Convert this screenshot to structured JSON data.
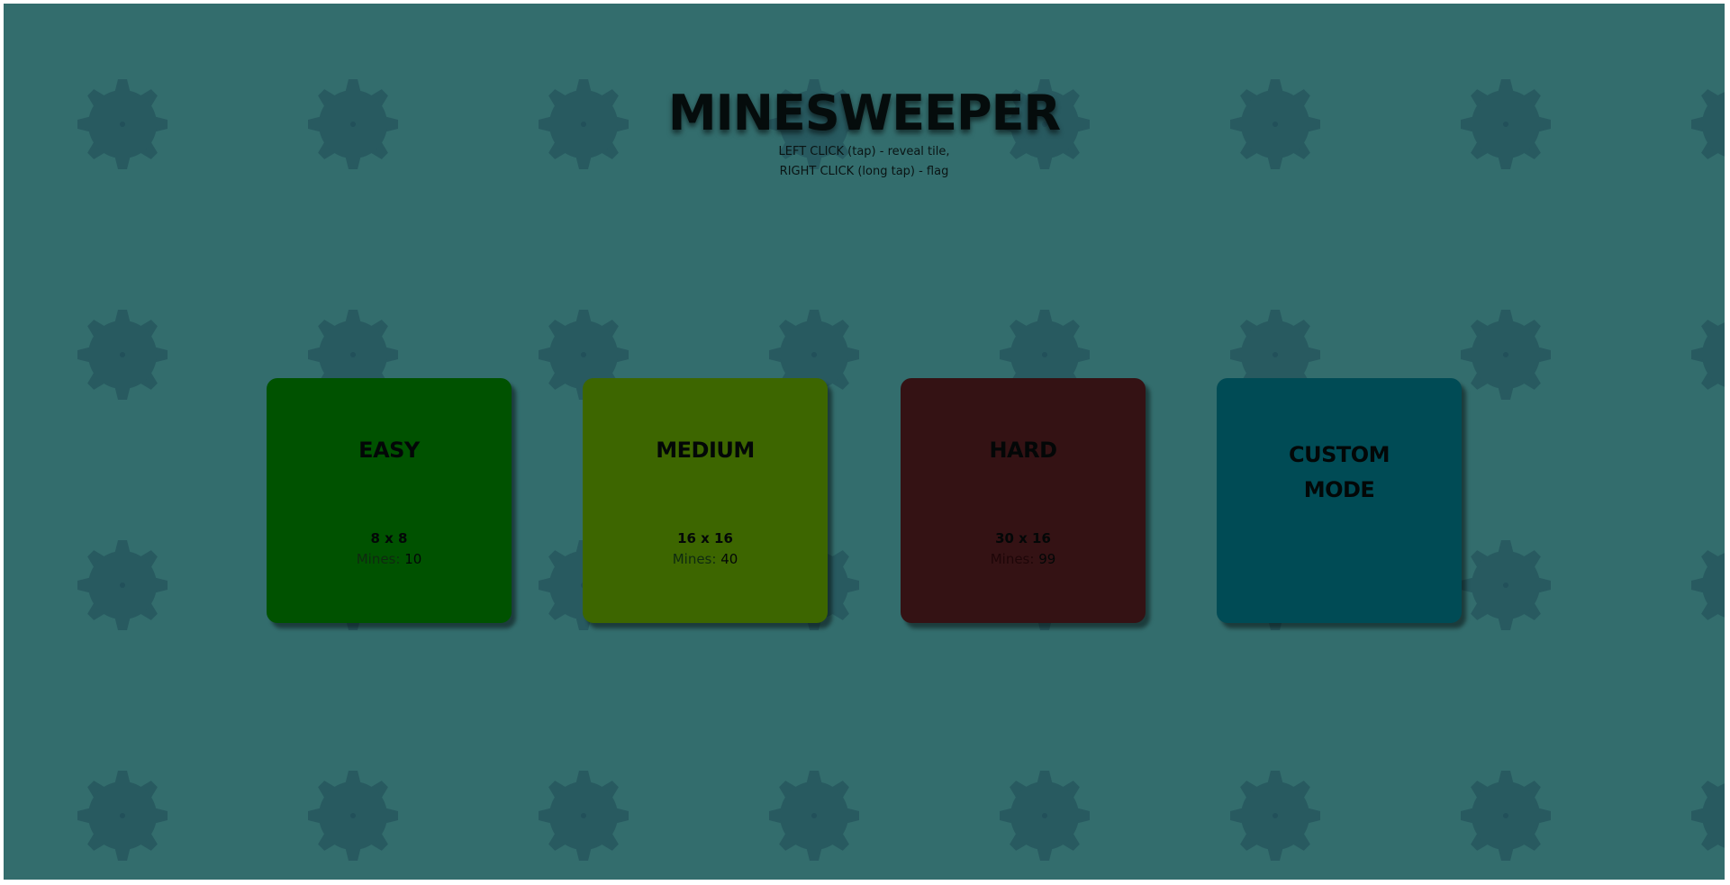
{
  "game": {
    "title": "MINESWEEPER",
    "instructions": [
      "LEFT CLICK (tap) - reveal tile,",
      "RIGHT CLICK (long tap) - flag"
    ]
  },
  "background": {
    "color": "#336d6d",
    "pattern_icon": "mine-icon",
    "pattern_color": "#285a60"
  },
  "modes": [
    {
      "id": "easy",
      "label": "EASY",
      "size": "8 x 8",
      "mines_label": "Mines:",
      "mines": "10",
      "color": "#005200"
    },
    {
      "id": "medium",
      "label": "MEDIUM",
      "size": "16 x 16",
      "mines_label": "Mines:",
      "mines": "40",
      "color": "#3d6600"
    },
    {
      "id": "hard",
      "label": "HARD",
      "size": "30 x 16",
      "mines_label": "Mines:",
      "mines": "99",
      "color": "#341214"
    },
    {
      "id": "custom",
      "label_line1": "CUSTOM",
      "label_line2": "MODE",
      "color": "#004b55"
    }
  ]
}
